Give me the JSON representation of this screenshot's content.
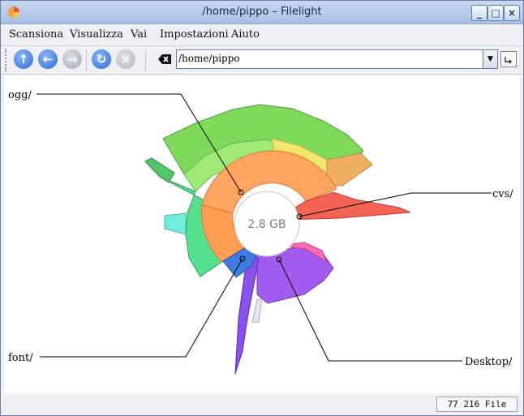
{
  "window": {
    "title": "/home/pippo – Filelight"
  },
  "menu": [
    "Scansiona",
    "Visualizza",
    "Vai",
    "Impostazioni",
    "Aiuto"
  ],
  "toolbar": {
    "location_value": "/home/pippo",
    "buttons": [
      "up-icon",
      "back-icon",
      "forward-icon",
      "refresh-icon",
      "stop-icon"
    ]
  },
  "chart": {
    "center_label": "2.8 GB",
    "labels": {
      "ogg": "ogg/",
      "cvs": "cvs/",
      "font": "font/",
      "desktop": "Desktop/"
    }
  },
  "status": {
    "files": "77 216 File"
  },
  "colors": {
    "accent": "#4a7fd4",
    "orange": "#ff9f55",
    "purple": "#9a55f0",
    "red": "#f05a55",
    "green": "#55e08a"
  }
}
